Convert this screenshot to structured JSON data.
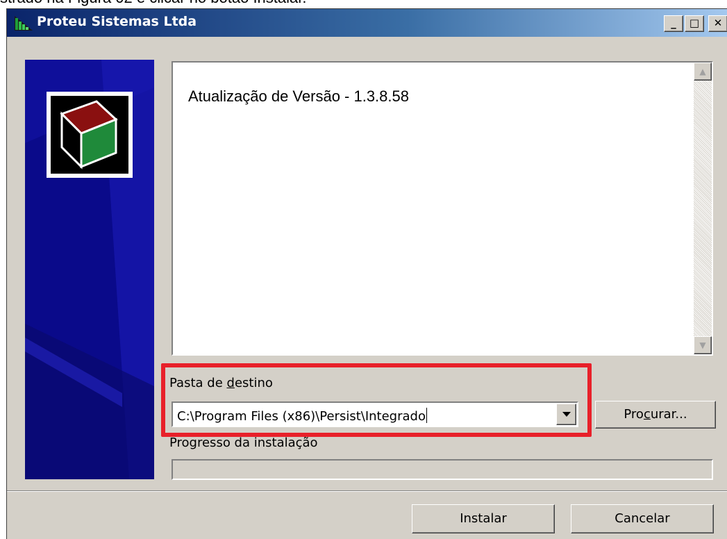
{
  "caption": "strado na Figura 02 e clicar no botão Instalar.",
  "window": {
    "title": "Proteu Sistemas Ltda",
    "minimize_label": "_",
    "maximize_label": "□",
    "close_label": "✕"
  },
  "notes": {
    "text": "Atualização de Versão - 1.3.8.58"
  },
  "destination": {
    "label_prefix": "Pasta de ",
    "label_accel": "d",
    "label_suffix": "estino",
    "value": "C:\\Program Files (x86)\\Persist\\Integrado",
    "browse_prefix": "Pro",
    "browse_accel": "c",
    "browse_suffix": "urar..."
  },
  "progress": {
    "label": "Progresso da instalação",
    "value": 0
  },
  "footer": {
    "install_label": "Instalar",
    "cancel_label": "Cancelar"
  },
  "colors": {
    "highlight": "#e8202a",
    "title_gradient_start": "#0a246a",
    "banner": "#0a0a8a"
  }
}
